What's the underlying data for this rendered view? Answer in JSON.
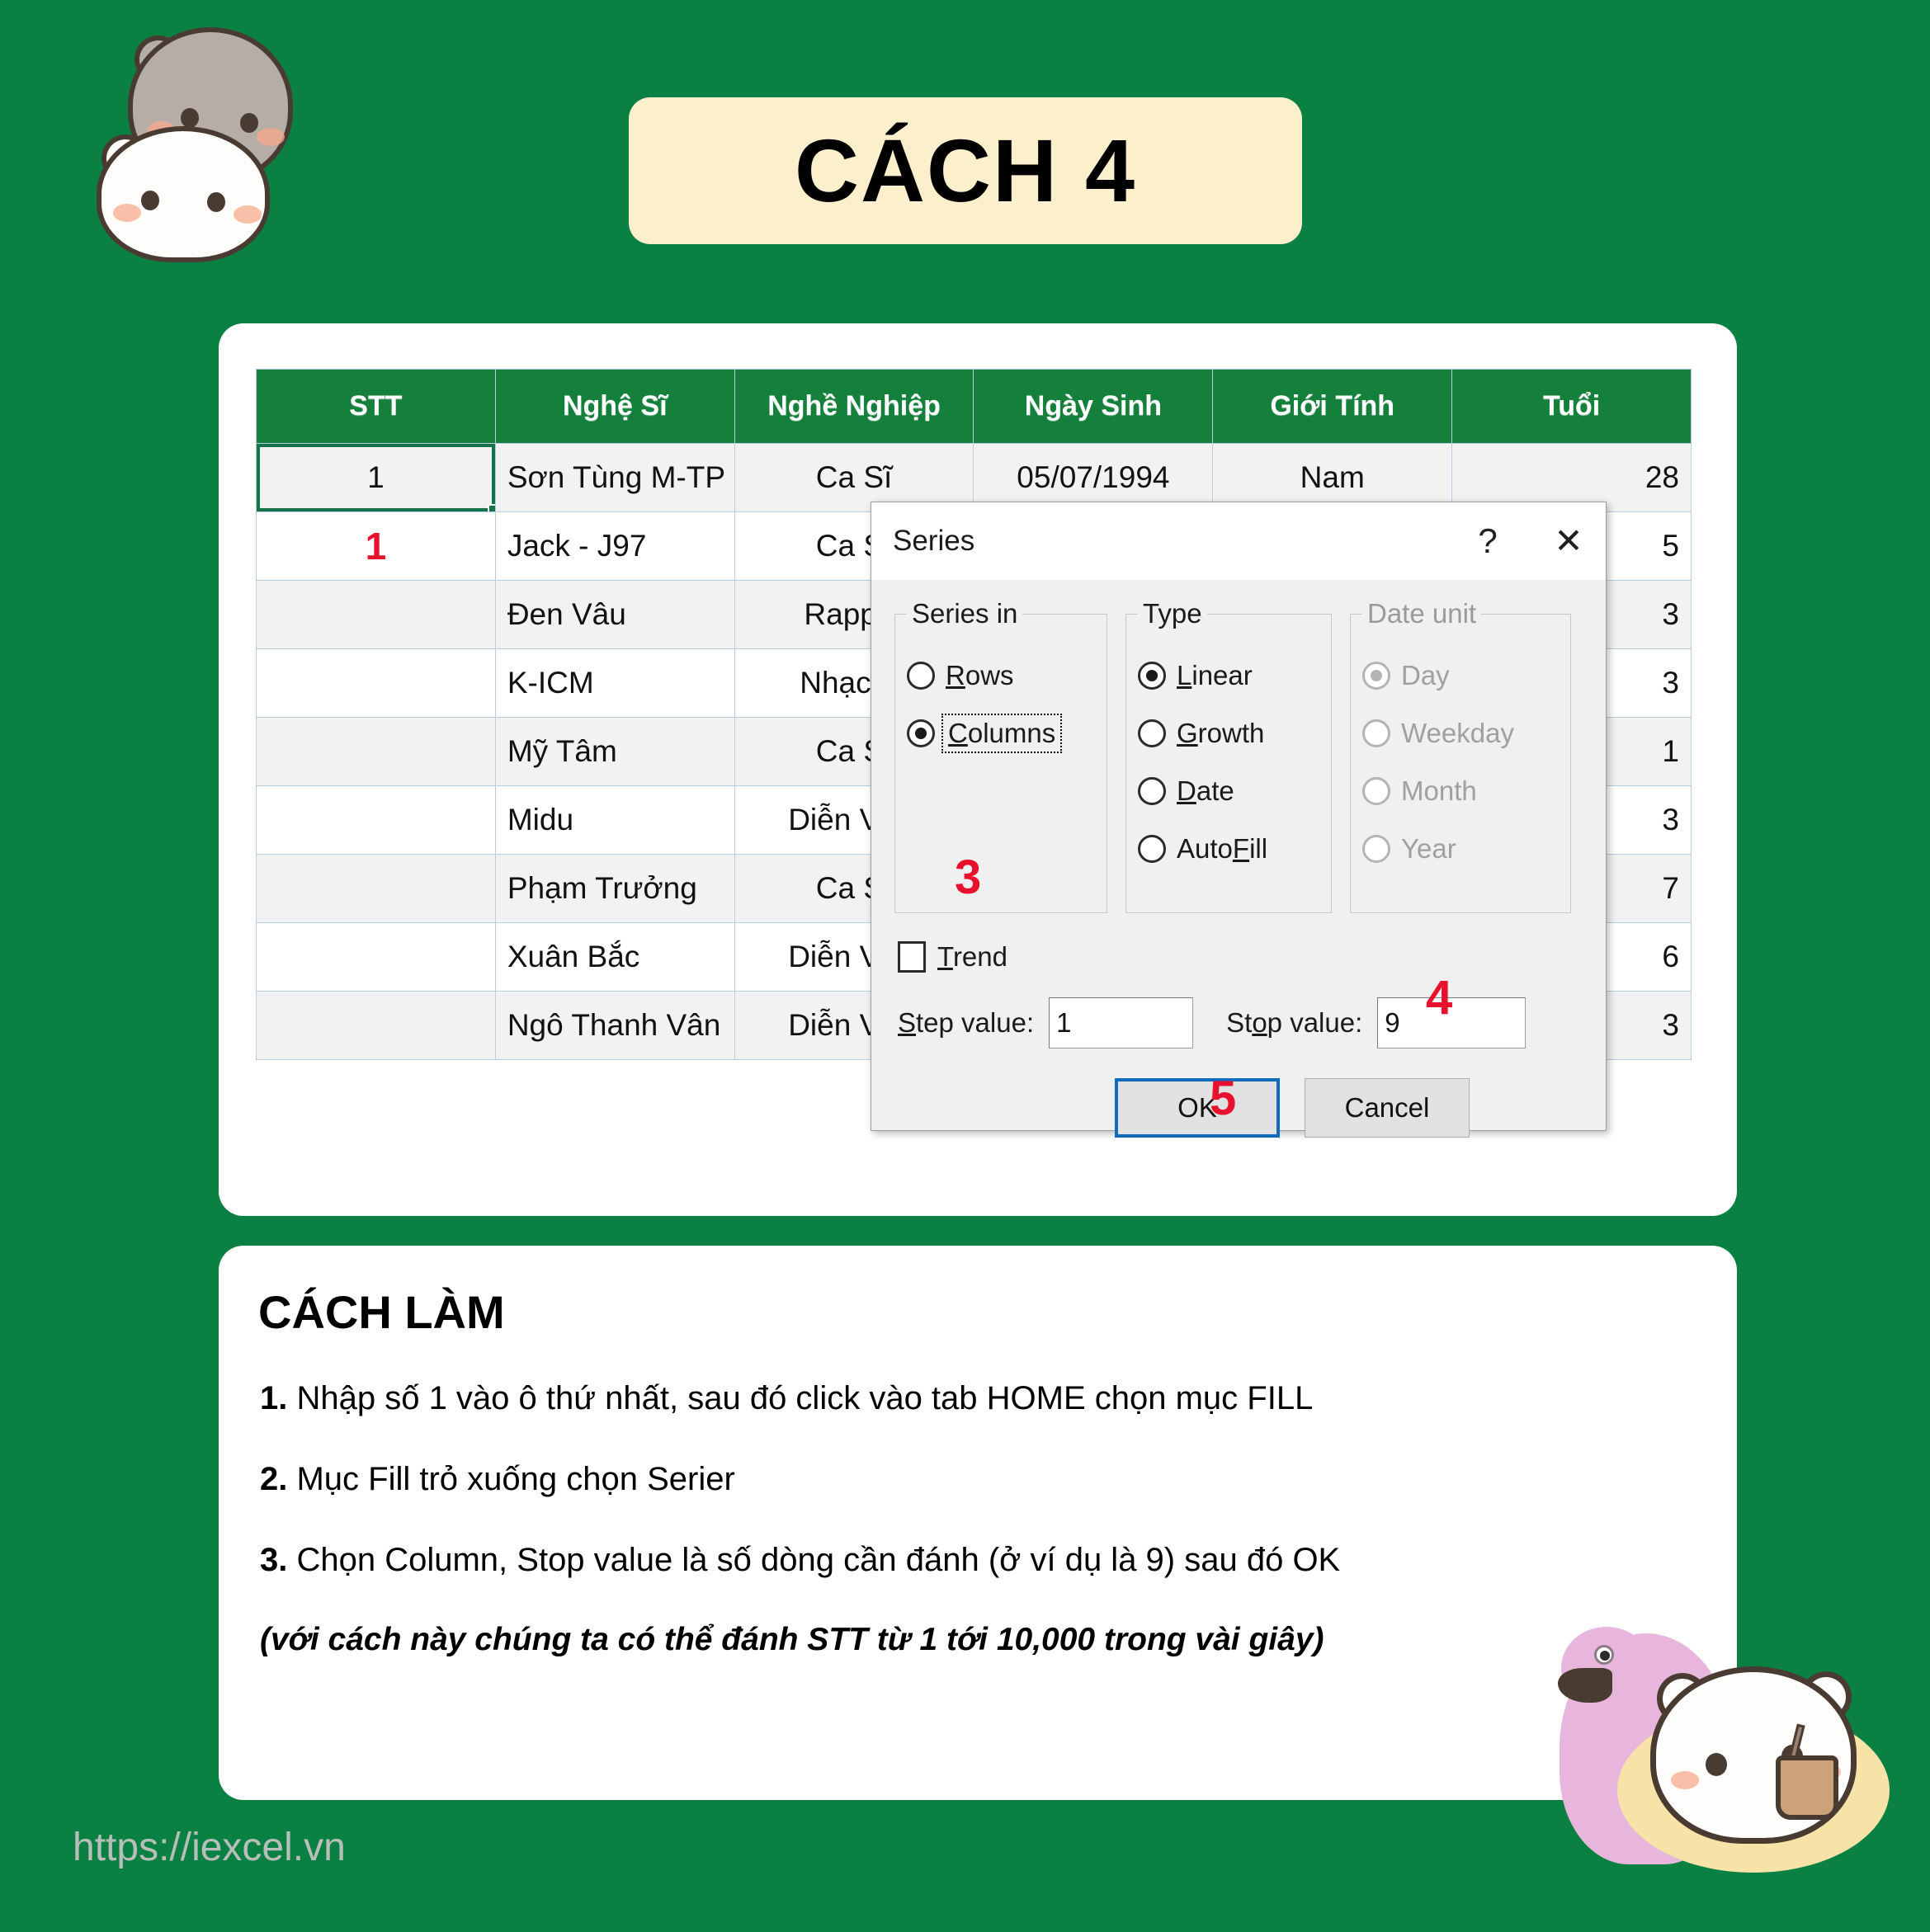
{
  "title": {
    "badge": "CÁCH 4"
  },
  "excel": {
    "headers": [
      "STT",
      "Nghệ Sĩ",
      "Nghề Nghiệp",
      "Ngày Sinh",
      "Giới Tính",
      "Tuổi"
    ],
    "rows": [
      {
        "stt": "1",
        "name": "Sơn Tùng M-TP",
        "job": "Ca Sĩ",
        "dob": "05/07/1994",
        "sex": "Nam",
        "age": "28"
      },
      {
        "stt": "1",
        "name": "Jack - J97",
        "job": "Ca Sĩ",
        "dob": "",
        "sex": "",
        "age": "5"
      },
      {
        "stt": "",
        "name": "Đen Vâu",
        "job": "Rapper",
        "dob": "",
        "sex": "",
        "age": "3"
      },
      {
        "stt": "",
        "name": "K-ICM",
        "job": "Nhạc Sĩ",
        "dob": "",
        "sex": "",
        "age": "3"
      },
      {
        "stt": "",
        "name": "Mỹ Tâm",
        "job": "Ca Sĩ",
        "dob": "",
        "sex": "",
        "age": "1"
      },
      {
        "stt": "",
        "name": "Midu",
        "job": "Diễn Viên",
        "dob": "",
        "sex": "",
        "age": "3"
      },
      {
        "stt": "",
        "name": "Phạm Trưởng",
        "job": "Ca Sĩ",
        "dob": "",
        "sex": "",
        "age": "7"
      },
      {
        "stt": "",
        "name": "Xuân Bắc",
        "job": "Diễn Viên",
        "dob": "",
        "sex": "",
        "age": "6"
      },
      {
        "stt": "",
        "name": "Ngô Thanh Vân",
        "job": "Diễn Viên",
        "dob": "",
        "sex": "",
        "age": "3"
      }
    ],
    "annotation_step1": "1"
  },
  "dialog": {
    "title": "Series",
    "help_icon": "?",
    "close_icon": "✕",
    "series_in": {
      "legend": "Series in",
      "options": [
        {
          "label": "Rows",
          "checked": false
        },
        {
          "label": "Columns",
          "checked": true
        }
      ],
      "annotation": "3"
    },
    "type": {
      "legend": "Type",
      "options": [
        {
          "label": "Linear",
          "checked": true
        },
        {
          "label": "Growth",
          "checked": false
        },
        {
          "label": "Date",
          "checked": false
        },
        {
          "label": "AutoFill",
          "checked": false
        }
      ]
    },
    "date_unit": {
      "legend": "Date unit",
      "disabled": true,
      "options": [
        {
          "label": "Day",
          "checked": true
        },
        {
          "label": "Weekday",
          "checked": false
        },
        {
          "label": "Month",
          "checked": false
        },
        {
          "label": "Year",
          "checked": false
        }
      ]
    },
    "trend": {
      "label": "Trend",
      "checked": false
    },
    "step_value": {
      "label": "Step value:",
      "value": "1"
    },
    "stop_value": {
      "label": "Stop value:",
      "value": "9",
      "annotation": "4"
    },
    "buttons": {
      "ok": "OK",
      "cancel": "Cancel",
      "ok_annotation": "5"
    }
  },
  "howto": {
    "title": "CÁCH LÀM",
    "items": [
      {
        "num": "1.",
        "text": " Nhập số 1 vào ô thứ nhất, sau đó click vào tab HOME chọn mục FILL"
      },
      {
        "num": "2.",
        "text": " Mục Fill trỏ xuống chọn Serier"
      },
      {
        "num": "3.",
        "text": " Chọn Column, Stop value là số dòng cần đánh (ở ví dụ là 9) sau đó OK"
      }
    ],
    "note": "(với cách này chúng ta có thể đánh STT từ 1 tới 10,000 trong vài giây)"
  },
  "footer": {
    "url": "https://iexcel.vn"
  },
  "colors": {
    "background_green": "#0B8043",
    "header_green": "#15803C",
    "badge_cream": "#FCEFCB",
    "annotation_red": "#E8112D",
    "primary_blue": "#0F6CBD"
  }
}
